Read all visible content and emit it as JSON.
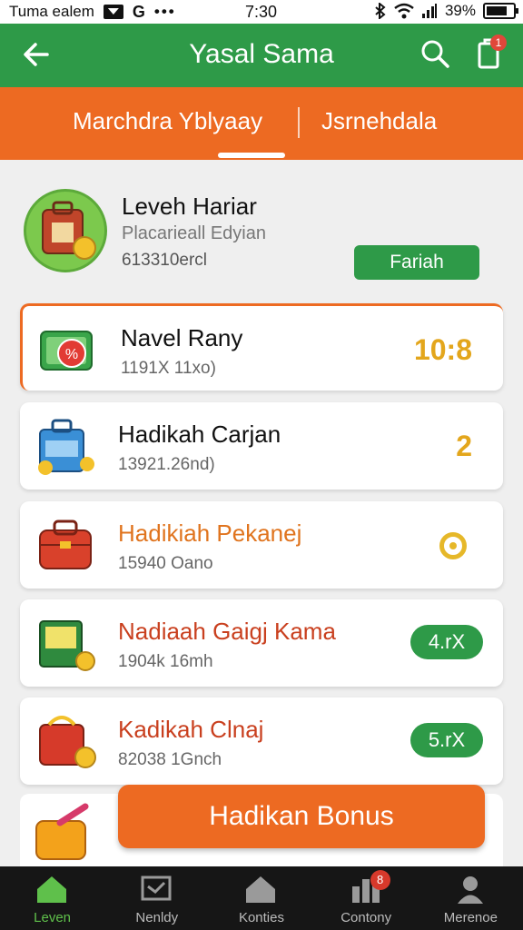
{
  "status_bar": {
    "left_text": "Tuma ealem",
    "google_glyph": "G",
    "dots": "•••",
    "time": "7:30",
    "battery_text": "39%",
    "icons": [
      "message-icon",
      "bluetooth-icon",
      "wifi-icon",
      "signal-icon",
      "battery-icon"
    ]
  },
  "header": {
    "title": "Yasal Sama",
    "icons": [
      "back-icon",
      "search-icon",
      "notification-icon"
    ],
    "badge_count": "1",
    "color": "#2e9a48"
  },
  "tabs": {
    "items": [
      {
        "label": "Marchdra Yblyaay"
      },
      {
        "label": "Jsrnehdala"
      }
    ],
    "selected_index": 0,
    "color": "#ed6a22"
  },
  "profile": {
    "name": "Leveh Hariar",
    "subtitle": "Placarieall Edyian",
    "meta": "613310ercl",
    "button_label": "Fariah",
    "icon": "wallet-bag-icon"
  },
  "rewards": [
    {
      "title": "Navel Rany",
      "subtitle": "1191X 11xo)",
      "value": "10:8",
      "value_style": "text",
      "icon": "green-wallet-icon"
    },
    {
      "title": "Hadikah Carjan",
      "subtitle": "13921.26nd)",
      "value": "2",
      "value_style": "text",
      "icon": "blue-bag-icon"
    },
    {
      "title": "Hadikiah Pekanej",
      "subtitle": "15940 Oano",
      "value": "",
      "value_style": "ring",
      "icon": "red-briefcase-icon"
    },
    {
      "title": "Nadiaah Gaigj Kama",
      "subtitle": "1904k 16mh",
      "value": "4.rX",
      "value_style": "pill",
      "icon": "green-book-icon"
    },
    {
      "title": "Kadikah Clnaj",
      "subtitle": "82038 1Gnch",
      "value": "5.rX",
      "value_style": "pill",
      "icon": "red-bag-coin-icon"
    }
  ],
  "bonus": {
    "label": "Hadikan Bonus",
    "icon": "gift-bag-icon"
  },
  "bottom_nav": {
    "items": [
      {
        "label": "Leven",
        "icon": "home-icon",
        "active": true
      },
      {
        "label": "Nenldy",
        "icon": "message-icon",
        "active": false
      },
      {
        "label": "Konties",
        "icon": "home-outline-icon",
        "active": false
      },
      {
        "label": "Contony",
        "icon": "stats-icon",
        "active": false,
        "badge": "8"
      },
      {
        "label": "Merenoe",
        "icon": "profile-icon",
        "active": false
      }
    ],
    "accent": "#5fc04b"
  }
}
